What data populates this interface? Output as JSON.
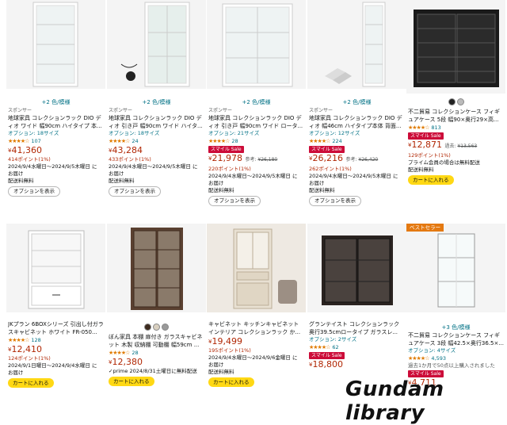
{
  "products_row1": [
    {
      "variants": "+2 色/模様",
      "sponsor": "スポンサー",
      "title": "地球家具 コレクションラック DIO ディオ ワイド 幅90cm ハイタイプ 本...",
      "option": "オプション: 18サイズ",
      "stars": "★★★★☆",
      "reviews": "107",
      "price": "41,360",
      "points": "414ポイント(1%)",
      "delivery1": "2024/9/4水曜日～2024/9/5木曜日 に",
      "delivery2": "お届け",
      "delivery3": "配送料無料",
      "button": "オプションを表示"
    },
    {
      "variants": "+2 色/模様",
      "sponsor": "スポンサー",
      "title": "地球家具 コレクションラック DIO ディオ 引き戸 幅90cm ワイド ハイタ...",
      "option": "オプション: 18サイズ",
      "stars": "★★★★☆",
      "reviews": "24",
      "price": "43,284",
      "points": "433ポイント(1%)",
      "delivery1": "2024/9/4水曜日～2024/9/5木曜日 に",
      "delivery2": "お届け",
      "delivery3": "配送料無料",
      "button": "オプションを表示"
    },
    {
      "variants": "+2 色/模様",
      "sponsor": "スポンサー",
      "title": "地球家具 コレクションラック DIO ディオ 引き戸 幅90cm ワイド ロータ...",
      "option": "オプション: 21サイズ",
      "stars": "★★★★☆",
      "reviews": "28",
      "badge": "スマイル Sale",
      "price": "21,978",
      "ref_label": "参考:",
      "ref_price": "¥26,180",
      "points": "220ポイント(1%)",
      "delivery1": "2024/9/4水曜日～2024/9/5木曜日 に",
      "delivery2": "お届け",
      "delivery3": "配送料無料",
      "button": "オプションを表示"
    },
    {
      "variants": "+2 色/模様",
      "sponsor": "スポンサー",
      "title": "地球家具 コレクションラック DIO ディオ 幅46cm ハイタイプ本体 背面...",
      "option": "オプション: 12サイズ",
      "stars": "★★★★☆",
      "reviews": "224",
      "badge": "スマイル Sale",
      "price": "26,216",
      "ref_label": "参考:",
      "ref_price": "¥26,420",
      "points": "262ポイント(1%)",
      "delivery1": "2024/9/4水曜日～2024/9/5木曜日 に",
      "delivery2": "お届け",
      "delivery3": "配送料無料",
      "button": "オプションを表示"
    },
    {
      "title": "不二貿易 コレクションケース フィギュアケース 5段 幅90×奥行29×高...",
      "stars": "★★★★☆",
      "reviews": "813",
      "badge": "スマイル Sale",
      "price": "12,871",
      "ref_label": "過去:",
      "ref_price": "¥13,563",
      "points": "129ポイント(1%)",
      "delivery1": "プライム会員の場合は無料配送",
      "button": "カートに入れる"
    }
  ],
  "products_row2": [
    {
      "title": "JKプラン 6BOXシリーズ 引出し付ガラスキャビネット ホワイト FR-050...",
      "stars": "★★★★☆",
      "reviews": "128",
      "price": "12,410",
      "points": "124ポイント(1%)",
      "delivery1": "2024/9/1日曜日～2024/9/4水曜日 に",
      "delivery2": "お届け",
      "button": "カートに入れる"
    },
    {
      "title": "ぼん家具 本棚 扉付き ガラスキャビネット 木製 収納棚 可動棚 幅59cm ...",
      "stars": "★★★★☆",
      "reviews": "28",
      "price": "12,380",
      "delivery1": "✓prime 2024/8/31土曜日に無料配送",
      "button": "カートに入れる"
    },
    {
      "title": "キャビネット キッチンキャビネット インテリア コレクションラック か...",
      "price": "19,499",
      "points": "195ポイント(1%)",
      "delivery1": "2024/9/4水曜日～2024/9/6金曜日 に",
      "delivery2": "お届け",
      "delivery3": "配送料無料",
      "button": "カートに入れる"
    },
    {
      "title": "グランテイスト コレクションラック 奥行39.5cmロータイプ ガラスレ...",
      "option": "オプション: 2サイズ",
      "stars": "★★★★☆",
      "reviews": "62",
      "badge": "スマイル Sale",
      "price": "18,800"
    },
    {
      "bestseller": "ベストセラー",
      "variants": "+3 色/模様",
      "title": "不二貿易 コレクションケース フィギュアケース 3段 幅42.5×奥行36.5×...",
      "option": "オプション: 4サイズ",
      "stars": "★★★★☆",
      "reviews": "4,593",
      "past_purchases": "過去1か月で50点以上購入されました",
      "badge": "スマイル Sale",
      "price": "4,711"
    }
  ],
  "currency_symbol": "¥",
  "watermark": "Gundam library"
}
